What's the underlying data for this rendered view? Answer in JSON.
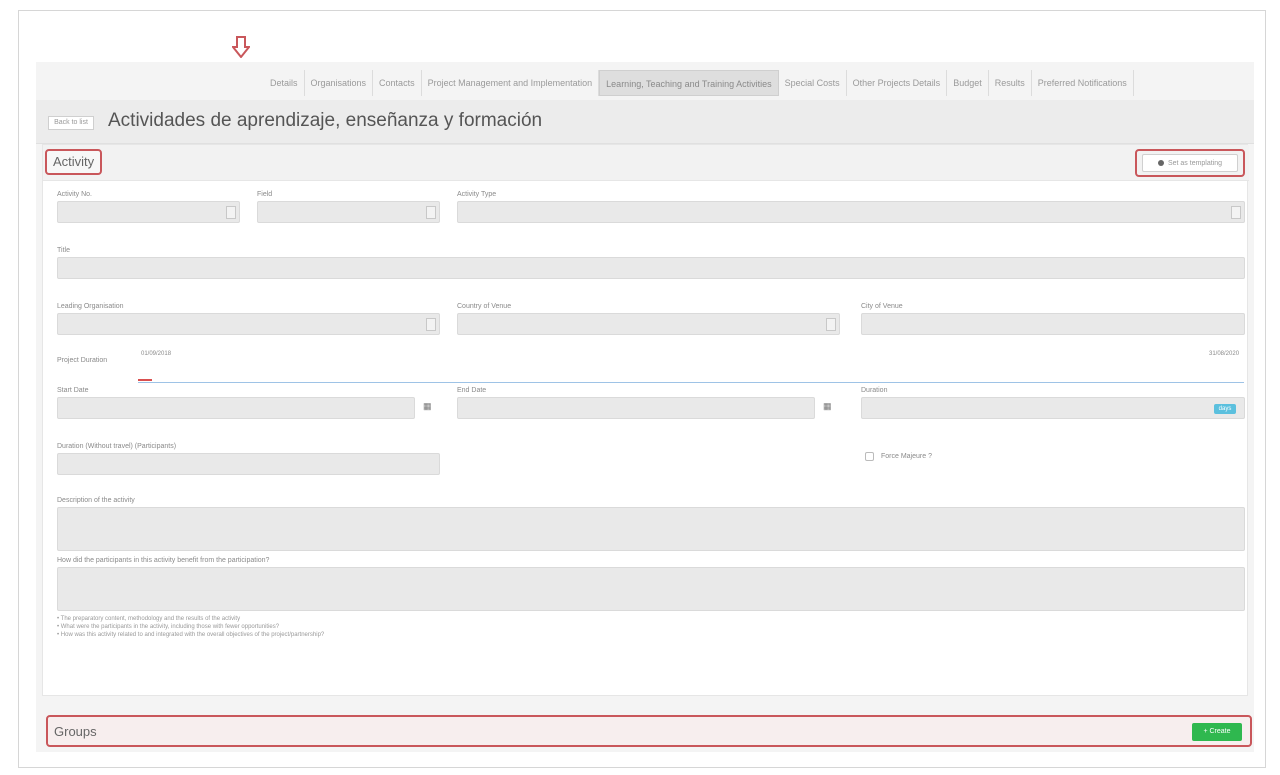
{
  "topnav": {
    "tabs": [
      "Details",
      "Organisations",
      "Contacts",
      "Project Management and Implementation",
      "Learning, Teaching and Training Activities",
      "Special Costs",
      "Other Projects Details",
      "Budget",
      "Results",
      "Preferred Notifications"
    ],
    "active_index": 4
  },
  "titlebar": {
    "back_label": "Back to list",
    "title": "Actividades de aprendizaje, enseñanza y formación"
  },
  "activity": {
    "section_label": "Activity",
    "top_right_button": "Set as templating",
    "fields": {
      "activity_no": "Activity No.",
      "field": "Field",
      "activity_type": "Activity Type",
      "title": "Title",
      "leading_org": "Leading Organisation",
      "country_of_venue": "Country of Venue",
      "city_of_venue": "City of Venue",
      "project_duration": "Project Duration",
      "start_date": "Start Date",
      "end_date": "End Date",
      "duration": "Duration",
      "duration_without_travel": "Duration (Without travel) (Participants)",
      "forced_majeure": "Force Majeure ?",
      "description": "Description of the activity",
      "participants_question": "How did the participants in this activity benefit from the participation?"
    },
    "ruler_start": "01/09/2018",
    "ruler_end": "31/08/2020",
    "duration_badge": "days",
    "hints": [
      "• The preparatory content, methodology and the results of the activity",
      "• What were the participants in the activity, including those with fewer opportunities?",
      "• How was this activity related to and integrated with the overall objectives of the project/partnership?"
    ]
  },
  "groups": {
    "label": "Groups",
    "create_label": "+ Create"
  },
  "colors": {
    "highlight": "#c9575b",
    "create_green": "#2fb84f",
    "badge_blue": "#5bc0de"
  }
}
